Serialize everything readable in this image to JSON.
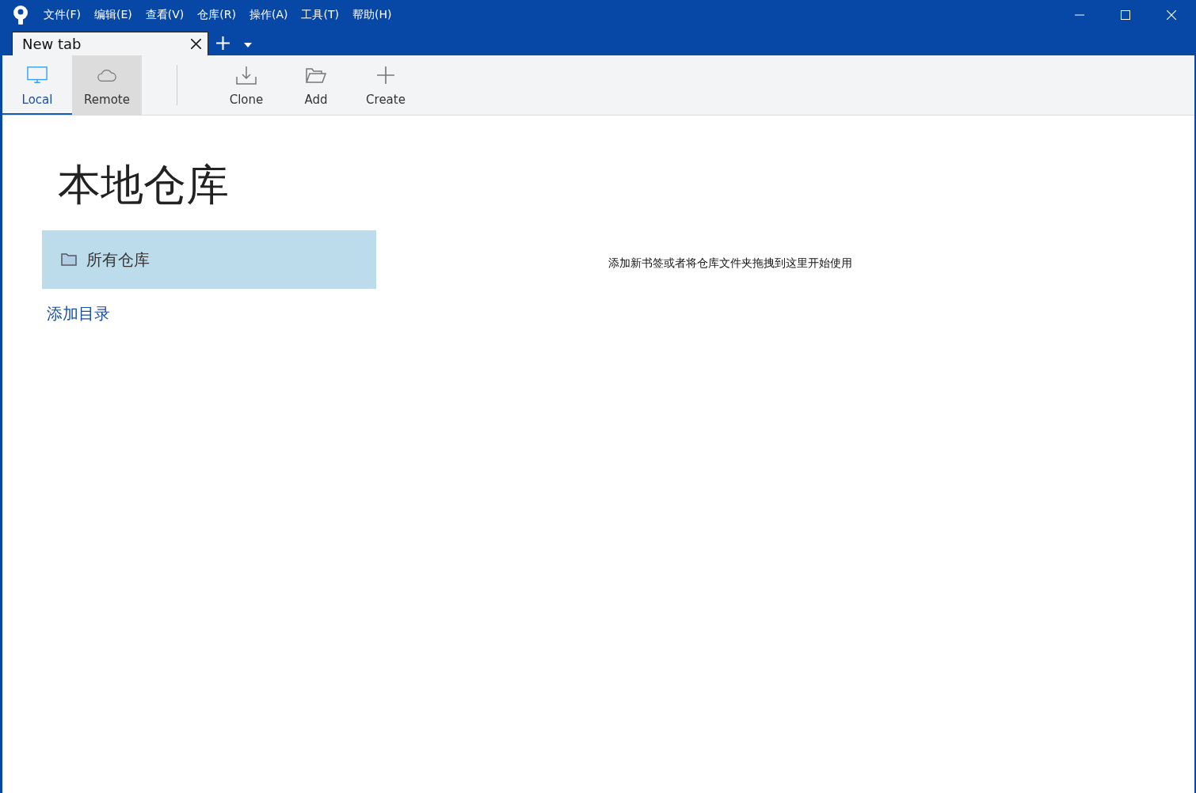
{
  "menu": [
    "文件(F)",
    "编辑(E)",
    "查看(V)",
    "仓库(R)",
    "操作(A)",
    "工具(T)",
    "帮助(H)"
  ],
  "tabs": [
    {
      "label": "New tab",
      "selected": true
    }
  ],
  "modes": [
    {
      "label": "Local",
      "kind": "monitor",
      "selected": true,
      "hovered": false
    },
    {
      "label": "Remote",
      "kind": "cloud",
      "selected": false,
      "hovered": true
    }
  ],
  "actions": [
    {
      "label": "Clone",
      "kind": "download"
    },
    {
      "label": "Add",
      "kind": "folder"
    },
    {
      "label": "Create",
      "kind": "plus"
    }
  ],
  "heading": "本地仓库",
  "sidebar": {
    "items": [
      {
        "label": "所有仓库",
        "selected": true
      }
    ],
    "link": "添加目录"
  },
  "empty_message": "添加新书签或者将仓库文件夹拖拽到这里开始使用"
}
